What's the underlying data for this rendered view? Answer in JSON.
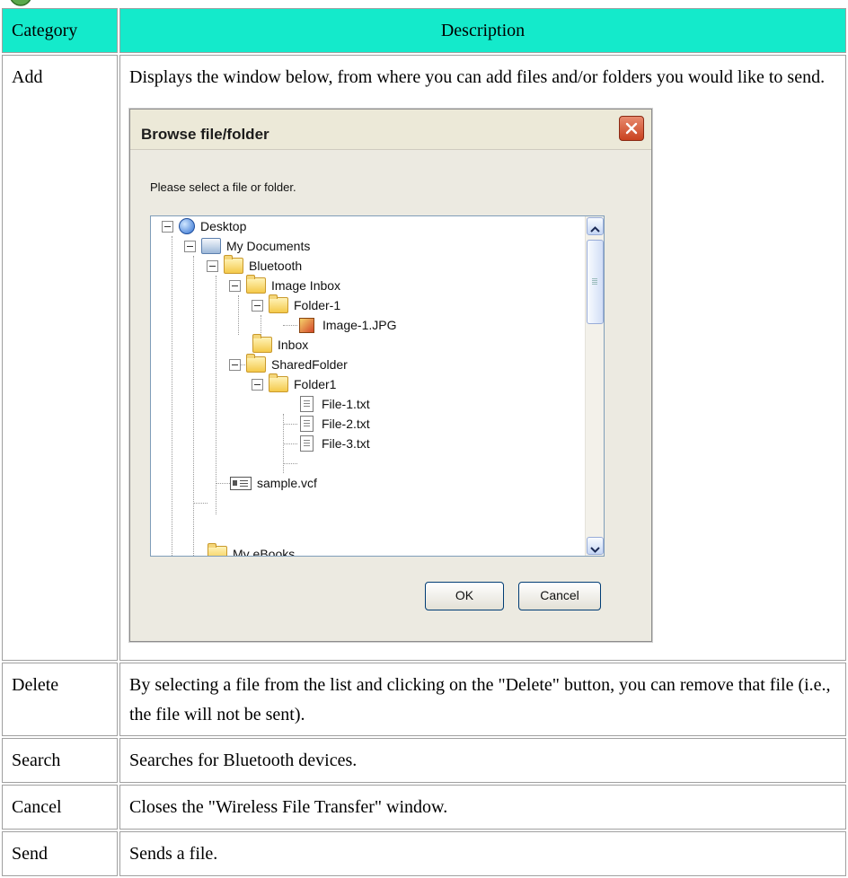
{
  "table": {
    "header": {
      "category": "Category",
      "description": "Description"
    },
    "rows": [
      {
        "category": "Add",
        "description": "Displays the window below, from where you can add files and/or folders you would like to send."
      },
      {
        "category": "Delete",
        "description": "By selecting a file from the list and clicking on the \"Delete\" button, you can remove that file (i.e., the file will not be sent)."
      },
      {
        "category": "Search",
        "description": "Searches for Bluetooth devices."
      },
      {
        "category": "Cancel",
        "description": "Closes the \"Wireless File Transfer\" window."
      },
      {
        "category": "Send",
        "description": "Sends a file."
      }
    ]
  },
  "dialog": {
    "title": "Browse file/folder",
    "prompt": "Please select a file or folder.",
    "tree": [
      {
        "label": "Desktop",
        "icon": "desktop-icon"
      },
      {
        "label": "My Documents",
        "icon": "my-documents-icon"
      },
      {
        "label": "Bluetooth",
        "icon": "folder-icon"
      },
      {
        "label": "Image Inbox",
        "icon": "folder-icon"
      },
      {
        "label": "Folder-1",
        "icon": "folder-icon"
      },
      {
        "label": "Image-1.JPG",
        "icon": "image-file-icon"
      },
      {
        "label": "Inbox",
        "icon": "folder-icon"
      },
      {
        "label": "SharedFolder",
        "icon": "folder-icon"
      },
      {
        "label": "Folder1",
        "icon": "folder-icon"
      },
      {
        "label": "File-1.txt",
        "icon": "text-file-icon"
      },
      {
        "label": "File-2.txt",
        "icon": "text-file-icon"
      },
      {
        "label": "File-3.txt",
        "icon": "text-file-icon"
      },
      {
        "label": "sample.vcf",
        "icon": "vcard-file-icon"
      },
      {
        "label": "My eBooks",
        "icon": "folder-icon"
      }
    ],
    "ok_label": "OK",
    "cancel_label": "Cancel"
  },
  "colors": {
    "header_bg": "#14eacb",
    "dialog_bg": "#eceae1"
  }
}
